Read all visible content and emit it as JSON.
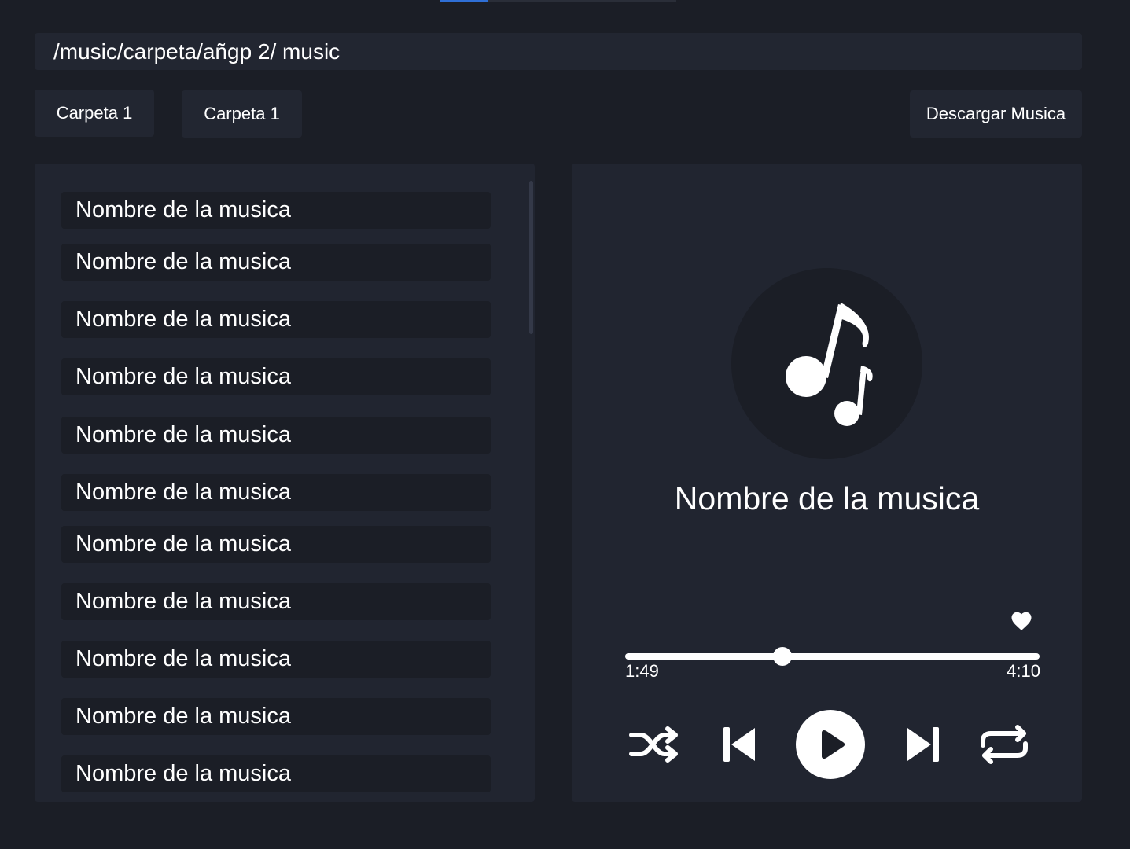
{
  "path": "/music/carpeta/añgp 2/ music",
  "folders": [
    "Carpeta 1",
    "Carpeta 1"
  ],
  "download_label": "Descargar Musica",
  "tracks": [
    "Nombre de la musica",
    "Nombre de la musica",
    "Nombre de la musica",
    "Nombre de la musica",
    "Nombre de la musica",
    "Nombre de la musica",
    "Nombre de la musica",
    "Nombre de la musica",
    "Nombre de la musica",
    "Nombre de la musica",
    "Nombre de la musica"
  ],
  "player": {
    "title": "Nombre de la musica",
    "elapsed": "1:49",
    "total": "4:10",
    "progress": 0.38,
    "icons": {
      "album": "music-notes-icon",
      "favorite": "heart-icon",
      "shuffle": "shuffle-icon",
      "previous": "skip-previous-icon",
      "play": "play-icon",
      "next": "skip-next-icon",
      "repeat": "repeat-icon"
    }
  },
  "colors": {
    "background": "#1b1e26",
    "panel": "#212530",
    "accent": "#2f6fd6",
    "text": "#ffffff"
  }
}
